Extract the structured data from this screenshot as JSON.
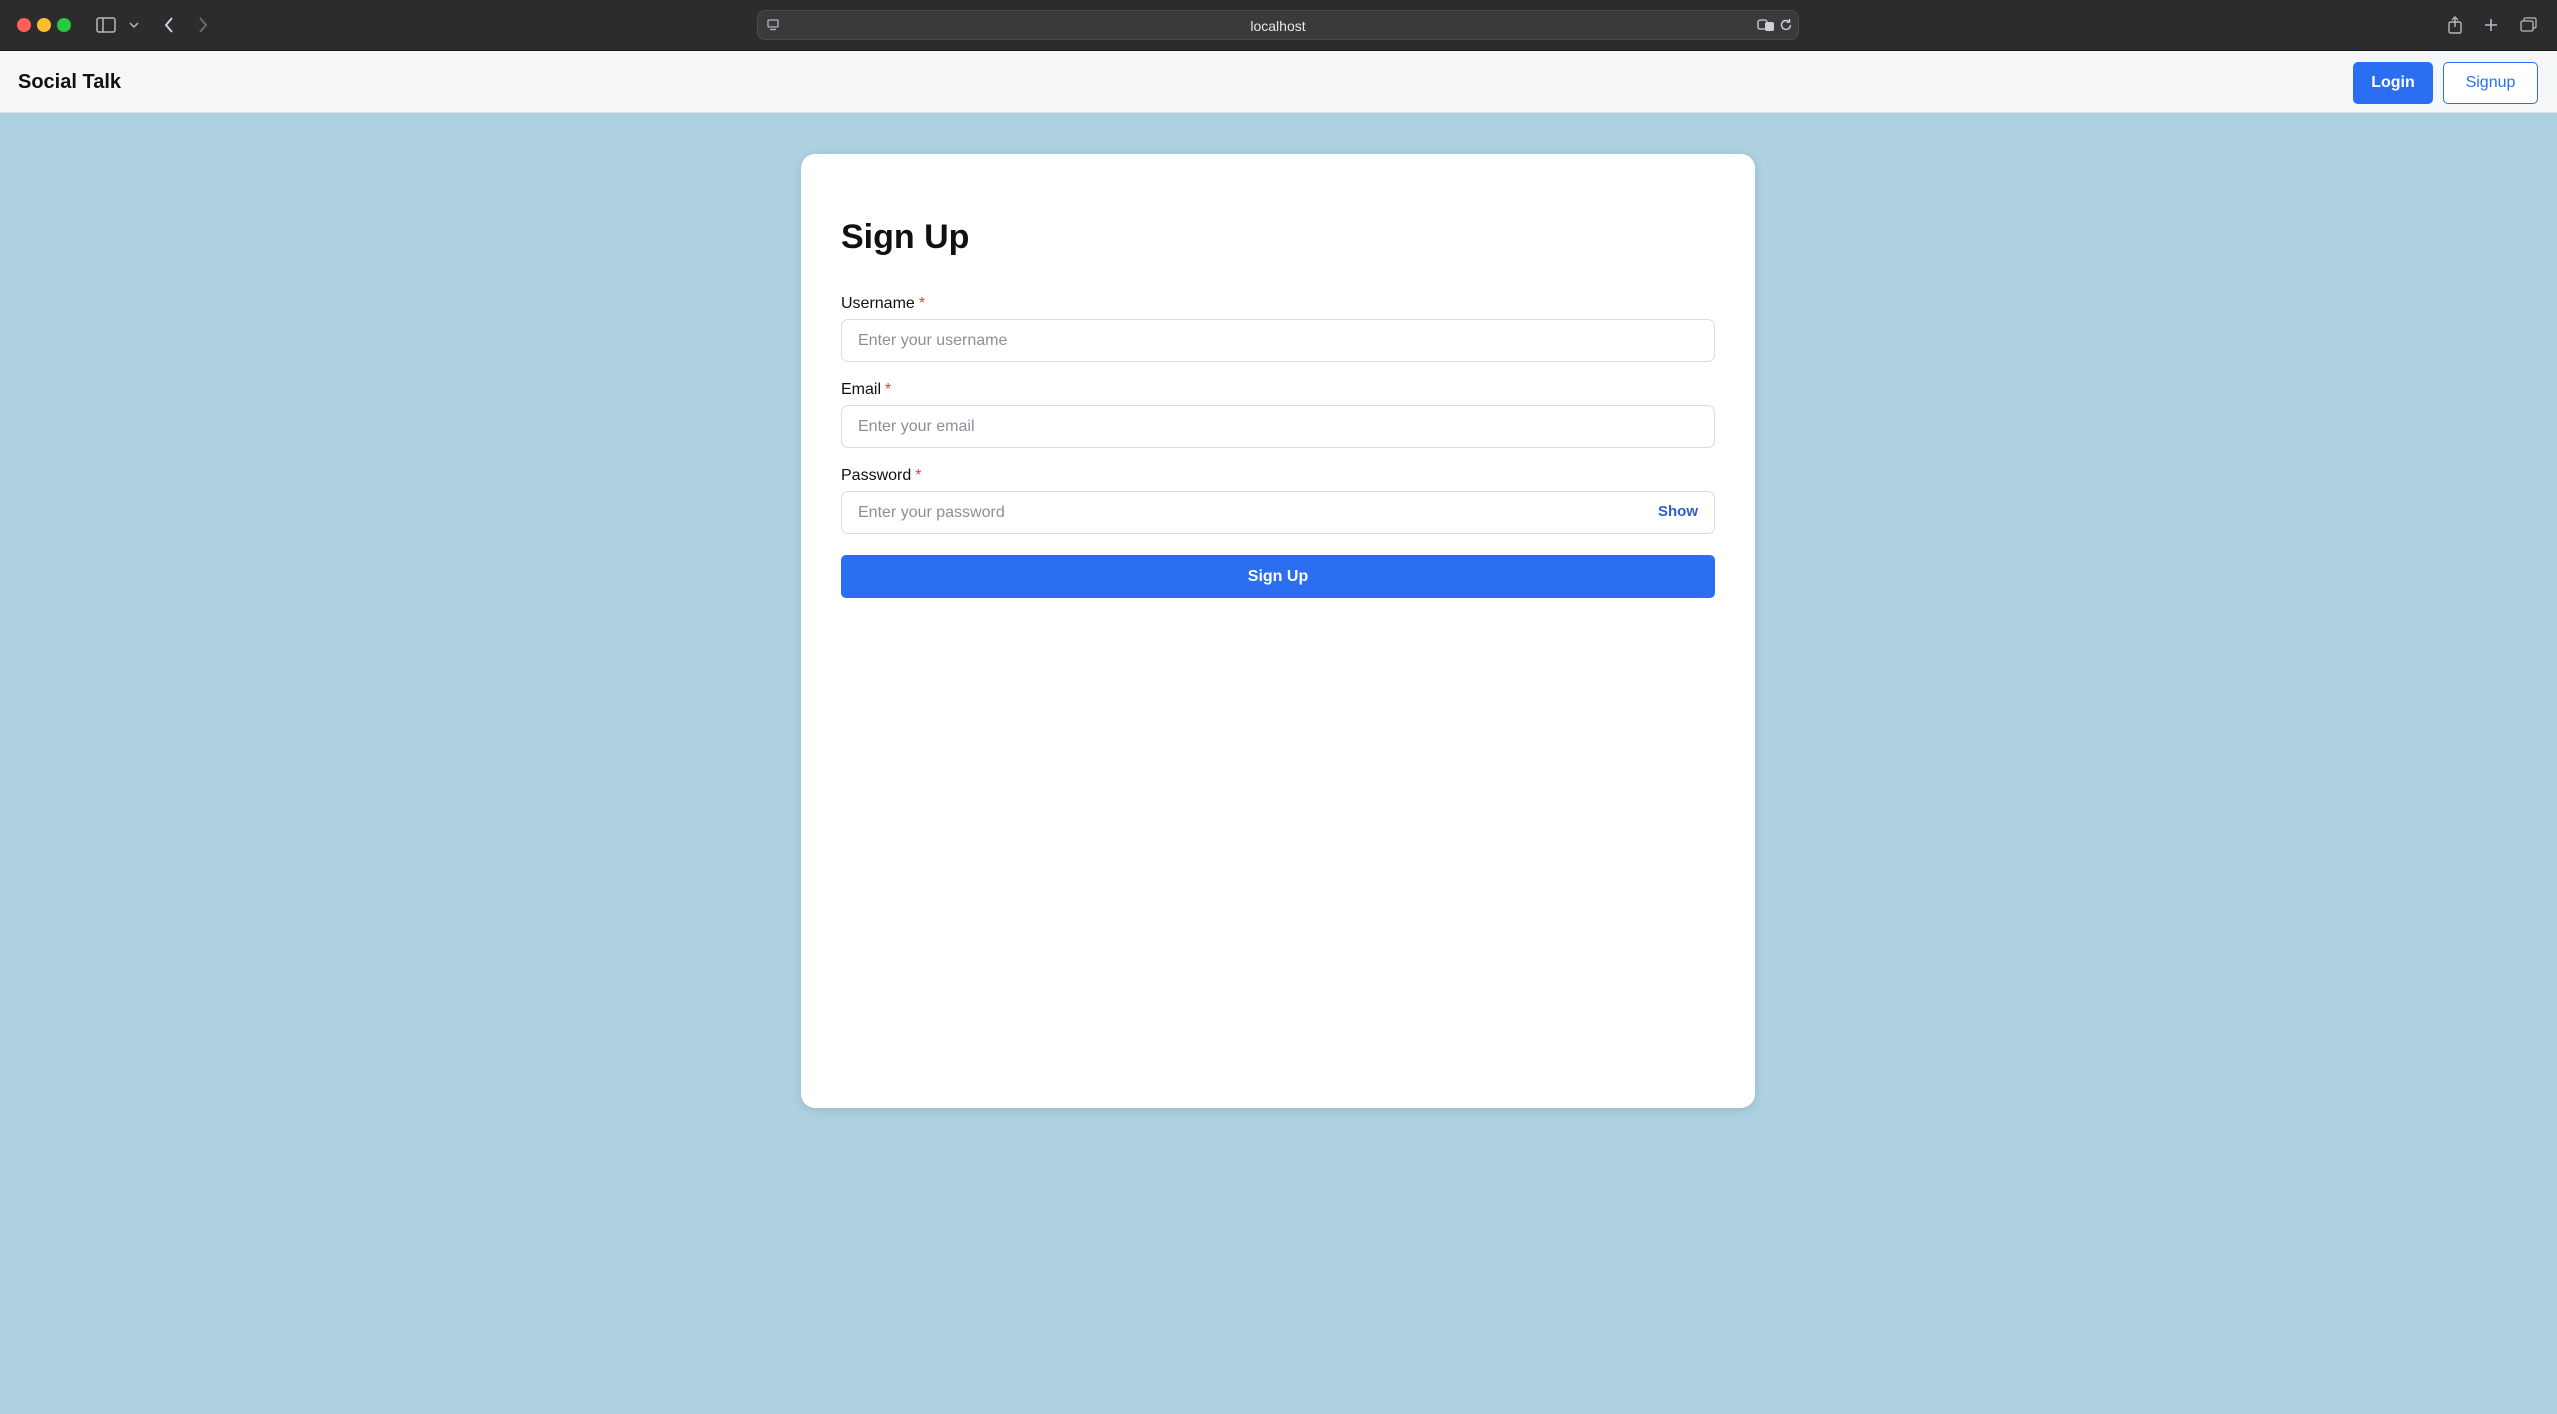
{
  "browser": {
    "url": "localhost",
    "icons": [
      "sidebar-icon",
      "chevron-down-icon",
      "back-icon",
      "forward-icon",
      "site-info-icon",
      "translate-icon",
      "reload-icon",
      "share-icon",
      "new-tab-icon",
      "tabs-overview-icon"
    ]
  },
  "nav": {
    "brand": "Social Talk",
    "login_label": "Login",
    "signup_label": "Signup"
  },
  "form": {
    "title": "Sign Up",
    "username": {
      "label": "Username",
      "required_mark": "*",
      "placeholder": "Enter your username",
      "value": ""
    },
    "email": {
      "label": "Email",
      "required_mark": "*",
      "placeholder": "Enter your email",
      "value": ""
    },
    "password": {
      "label": "Password",
      "required_mark": "*",
      "placeholder": "Enter your password",
      "value": "",
      "toggle_label": "Show"
    },
    "submit_label": "Sign Up"
  },
  "colors": {
    "background": "#aed1e1",
    "primary": "#2b6ef2",
    "required": "#e53e3e"
  }
}
